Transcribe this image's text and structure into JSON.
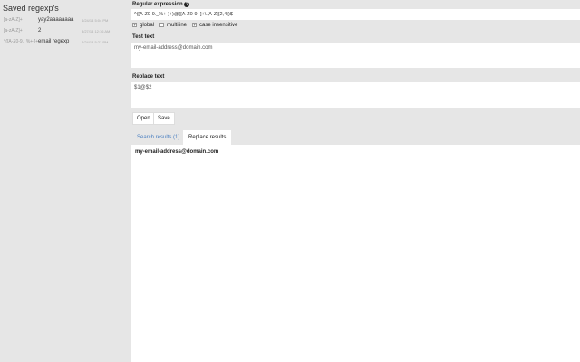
{
  "sidebar": {
    "title": "Saved regexp's",
    "items": [
      {
        "pattern": "[a-zA-Z]+",
        "name": "yay2aaaaaaaa",
        "time": "4/24/14 5:04 PM"
      },
      {
        "pattern": "[a-zA-Z]+",
        "name": "2",
        "time": "3/27/14 12:16 AM"
      },
      {
        "pattern": "^([A-Z0-9._%+-]+)...",
        "name": "email regexp",
        "time": "4/24/14 5:21 PM"
      }
    ]
  },
  "regex": {
    "label": "Regular expression",
    "value": "^([A-Z0-9._%+-]+)@([A-Z0-9.-]+\\.[A-Z]{2,4})$",
    "flags": [
      {
        "label": "global",
        "checked": true
      },
      {
        "label": "multiline",
        "checked": false
      },
      {
        "label": "case insensitive",
        "checked": true
      }
    ]
  },
  "test": {
    "label": "Test text",
    "value": "my-email-address@domain.com"
  },
  "replace": {
    "label": "Replace text",
    "value": "$1@$2"
  },
  "buttons": {
    "open": "Open",
    "save": "Save"
  },
  "tabs": {
    "search": "Search results (1)",
    "replace": "Replace results"
  },
  "result": "my-email-address@domain.com"
}
